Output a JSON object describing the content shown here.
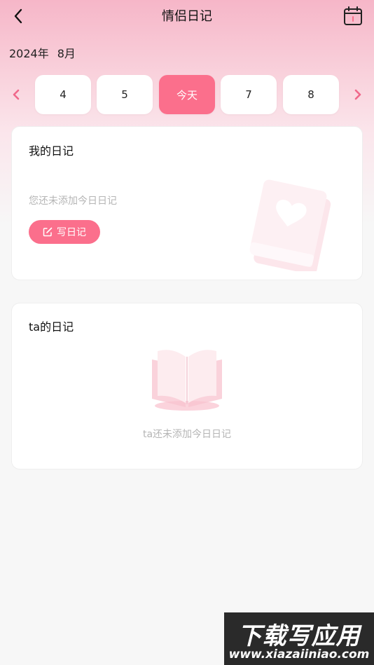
{
  "header": {
    "title": "情侣日记",
    "back_icon": "chevron-left-icon",
    "calendar_icon": "calendar-icon"
  },
  "month": {
    "year": "2024年",
    "month": "8月"
  },
  "date_strip": {
    "days": [
      {
        "label": "4",
        "active": false
      },
      {
        "label": "5",
        "active": false
      },
      {
        "label": "今天",
        "active": true
      },
      {
        "label": "7",
        "active": false
      },
      {
        "label": "8",
        "active": false
      }
    ]
  },
  "my_diary": {
    "title": "我的日记",
    "empty_text": "您还未添加今日日记",
    "write_button": "写日记"
  },
  "ta_diary": {
    "title": "ta的日记",
    "empty_text": "ta还未添加今日日记"
  },
  "watermark": {
    "title": "下载写应用",
    "url": "www.xiazaiiniao.com"
  },
  "colors": {
    "accent": "#fb6f8c",
    "header_gradient_top": "#f6b6c8",
    "background": "#f7f7f7",
    "muted_text": "#b5b5b5"
  }
}
